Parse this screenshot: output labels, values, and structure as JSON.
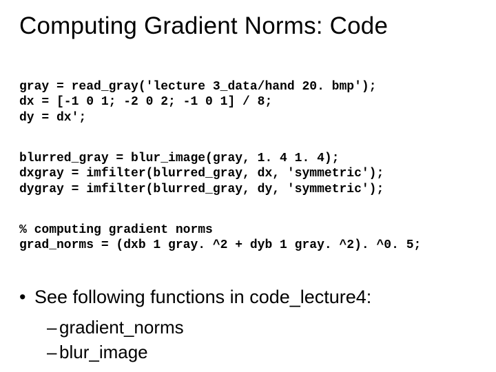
{
  "title": "Computing Gradient Norms: Code",
  "code": {
    "l1": "gray = read_gray('lecture 3_data/hand 20. bmp');",
    "l2": "dx = [-1 0 1; -2 0 2; -1 0 1] / 8;",
    "l3": "dy = dx';",
    "l4": "blurred_gray = blur_image(gray, 1. 4 1. 4);",
    "l5": "dxgray = imfilter(blurred_gray, dx, 'symmetric');",
    "l6": "dygray = imfilter(blurred_gray, dy, 'symmetric');",
    "l7": "% computing gradient norms",
    "l8": "grad_norms = (dxb 1 gray. ^2 + dyb 1 gray. ^2). ^0. 5;"
  },
  "bullets": {
    "lead": "See following functions in code_lecture4:",
    "items": [
      "gradient_norms",
      "blur_image"
    ]
  }
}
